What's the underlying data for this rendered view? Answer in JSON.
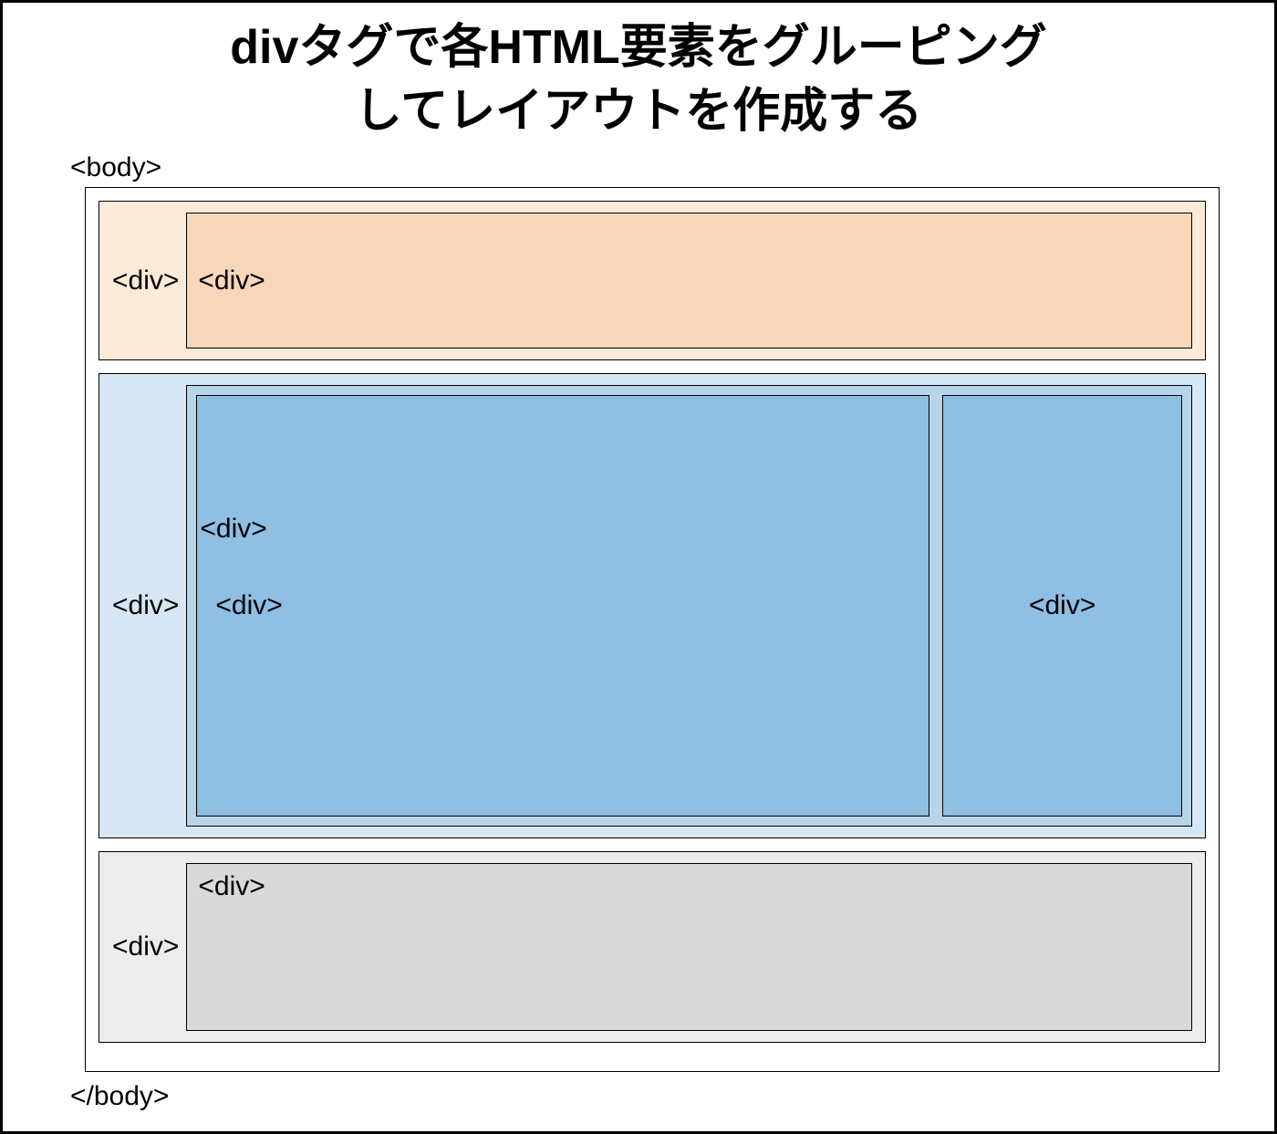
{
  "title": {
    "line1": "divタグで各HTML要素をグルーピング",
    "line2": "してレイアウトを作成する"
  },
  "body_open": "<body>",
  "body_close": "</body>",
  "sections": {
    "header": {
      "outer": "<div>",
      "inner": "<div>"
    },
    "main": {
      "outer": "<div>",
      "wrapper": "<div>",
      "content": "<div>",
      "sidebar": "<div>"
    },
    "footer": {
      "outer": "<div>",
      "inner": "<div>"
    }
  },
  "colors": {
    "header_outer": "#fcead9",
    "header_inner": "#f7d7bb",
    "main_outer": "#d6e6f5",
    "main_inner": "#b8d4eb",
    "main_content": "#8fbfe3",
    "footer_outer": "#ececec",
    "footer_inner": "#d9d9d9"
  }
}
